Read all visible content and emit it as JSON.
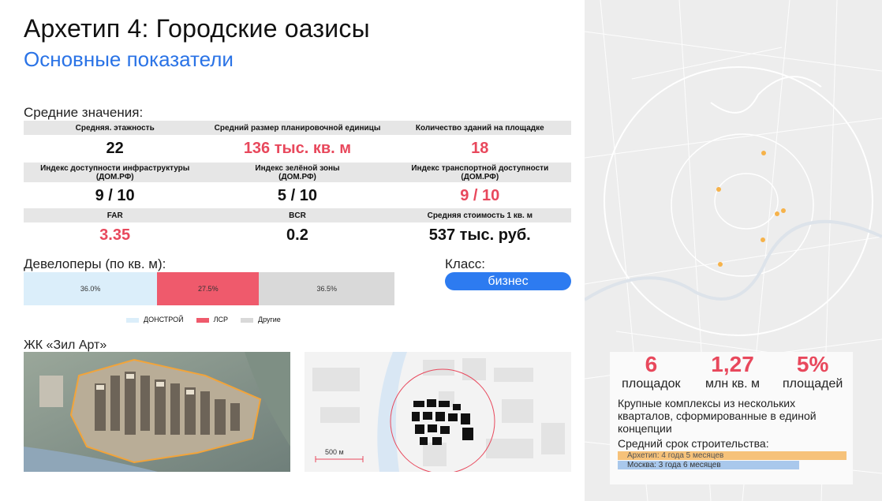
{
  "header": {
    "title": "Архетип 4: Городские оазисы",
    "subtitle": "Основные показатели"
  },
  "averages": {
    "label": "Средние значения:",
    "rows": [
      {
        "headers": [
          "Средняя. этажность",
          "Средний размер планировочной единицы",
          "Количество зданий на площадке"
        ],
        "values": [
          "22",
          "136 тыс. кв. м",
          "18"
        ]
      },
      {
        "headers": [
          "Индекс доступности инфраструктуры\n(ДОМ.РФ)",
          "Индекс зелёной зоны\n(ДОМ.РФ)",
          "Индекс транспортной доступности\n(ДОМ.РФ)"
        ],
        "values": [
          "9 / 10",
          "5 / 10",
          "9 / 10"
        ]
      },
      {
        "headers": [
          "FAR",
          "BCR",
          "Средняя стоимость 1 кв. м"
        ],
        "values": [
          "3.35",
          "0.2",
          "537 тыс. руб."
        ]
      }
    ]
  },
  "developers": {
    "label": "Девелоперы (по кв. м):",
    "segments": [
      {
        "name": "ДОНСТРОЙ",
        "value": 36.0,
        "label": "36.0%",
        "color": "#dbeefa"
      },
      {
        "name": "ЛСР",
        "value": 27.5,
        "label": "27.5%",
        "color": "#ef5a6c"
      },
      {
        "name": "Другие",
        "value": 36.5,
        "label": "36.5%",
        "color": "#d9d9d9"
      }
    ]
  },
  "class": {
    "label": "Класс:",
    "value": "бизнес"
  },
  "project": {
    "label": "ЖК «Зил Арт»",
    "scale_label": "500 м"
  },
  "stats": [
    {
      "value": "6",
      "label": "площадок"
    },
    {
      "value": "1,27",
      "label": "млн кв. м"
    },
    {
      "value": "5%",
      "label": "площадей"
    }
  ],
  "description": "Крупные комплексы из нескольких кварталов, сформированные в единой концепции",
  "duration": {
    "label": "Средний срок строительства:",
    "bars": [
      {
        "text": "Архетип: 4 года 5 месяцев",
        "value_months": 53,
        "color": "#f6c27a"
      },
      {
        "text": "Москва: 3 года 6 месяцев",
        "value_months": 42,
        "color": "#a9c8ec"
      }
    ]
  },
  "colors": {
    "accent_red": "#e8485c",
    "accent_blue": "#2a73e6"
  }
}
